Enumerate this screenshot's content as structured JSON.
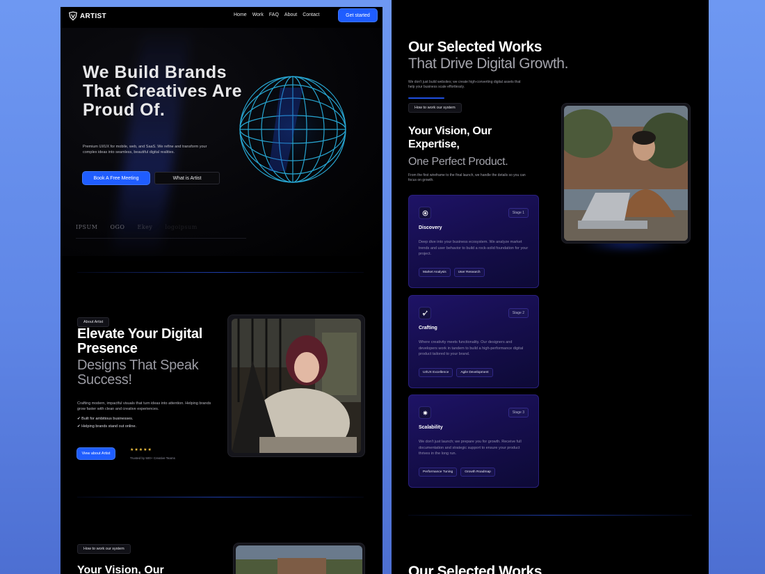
{
  "nav": {
    "logo_text": "ARTIST",
    "links": [
      "Home",
      "Work",
      "FAQ",
      "About",
      "Contact"
    ],
    "cta": "Get started"
  },
  "hero": {
    "title": "We Build Brands That Creatives Are Proud Of.",
    "subtitle": "Premium UI/UX for mobile, web, and SaaS. We refine and transform your complex ideas into seamless, beautiful digital realities.",
    "primary_button": "Book A Free Meeting",
    "secondary_button": "What is Artist",
    "partner_logos": [
      "IPSUM",
      "OGO",
      "Ekey",
      "logoipsum"
    ]
  },
  "about": {
    "pill": "About Artist",
    "title": "Elevate Your Digital Presence",
    "title_secondary": "Designs That Speak Success!",
    "description": "Crafting modern, impactful visuals that turn ideas into attention. Helping brands grow faster with clean and creative experiences.",
    "checks": [
      "Built for ambitious businesses.",
      "Helping brands stand out online."
    ],
    "button": "View about Artist",
    "stars": "★★★★★",
    "trusted": "Trusted by 500+ Creative Teams"
  },
  "system_preview": {
    "pill": "How to work our system",
    "title": "Your Vision, Our"
  },
  "works": {
    "title": "Our Selected Works",
    "title_secondary": "That Drive Digital Growth.",
    "description": "We don't just build websites; we create high-converting digital assets that help your business scale effortlessly.",
    "pill": "How to work our system",
    "vision_title": "Your Vision, Our Expertise,",
    "vision_title_secondary": "One Perfect Product.",
    "vision_description": "From the first wireframe to the final launch, we handle the details so you can focus on growth.",
    "bottom_title": "Our Selected Works"
  },
  "stages": [
    {
      "badge": "Stage 1",
      "name": "Discovery",
      "icon": "target-icon",
      "description": "Deep dive into your business ecosystem. We analyze market trends and user behavior to build a rock-solid foundation for your project.",
      "tags": [
        "Market Analysis",
        "User Research"
      ]
    },
    {
      "badge": "Stage 2",
      "name": "Crafting",
      "icon": "pen-icon",
      "description": "Where creativity meets functionality. Our designers and developers work in tandem to build a high-performance digital product tailored to your brand.",
      "tags": [
        "UI/UX Excellence",
        "Agile Development"
      ]
    },
    {
      "badge": "Stage 3",
      "name": "Scalability",
      "icon": "growth-icon",
      "description": "We don't just launch; we prepare you for growth. Receive full documentation and strategic support to ensure your product thrives in the long run.",
      "tags": [
        "Performance Tuning",
        "Growth Roadmap"
      ]
    }
  ],
  "colors": {
    "accent": "#1f5dff",
    "background": "#000000",
    "stage_card": "#1e1366",
    "star": "#f5c542"
  }
}
